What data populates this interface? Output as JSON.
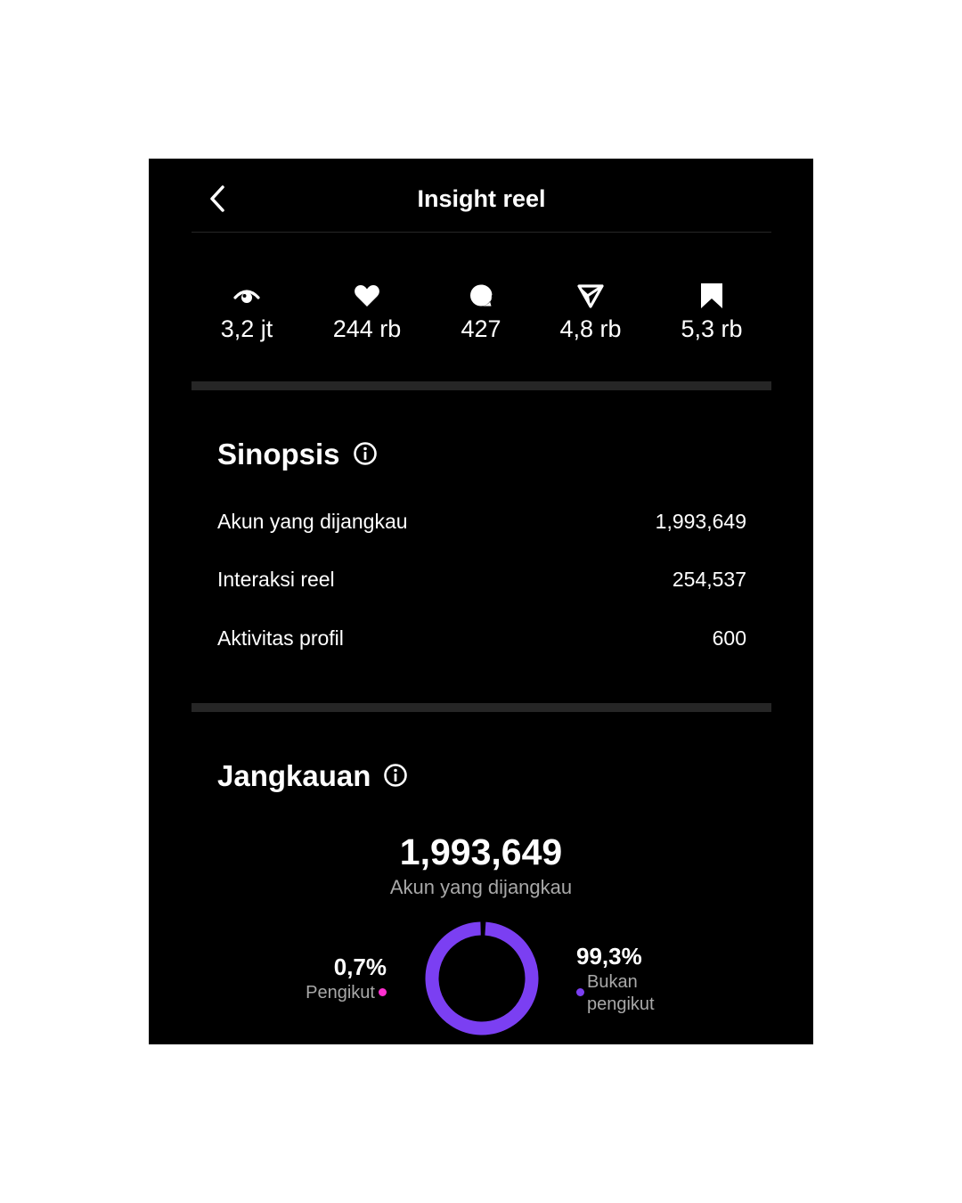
{
  "header": {
    "title": "Insight reel"
  },
  "stats": [
    {
      "icon": "eye-icon",
      "value": "3,2 jt"
    },
    {
      "icon": "heart-icon",
      "value": "244 rb"
    },
    {
      "icon": "comment-icon",
      "value": "427"
    },
    {
      "icon": "share-icon",
      "value": "4,8 rb"
    },
    {
      "icon": "bookmark-icon",
      "value": "5,3 rb"
    }
  ],
  "synopsis": {
    "title": "Sinopsis",
    "rows": [
      {
        "label": "Akun yang dijangkau",
        "value": "1,993,649"
      },
      {
        "label": "Interaksi reel",
        "value": "254,537"
      },
      {
        "label": "Aktivitas profil",
        "value": "600"
      }
    ]
  },
  "reach": {
    "title": "Jangkauan",
    "total": "1,993,649",
    "total_label": "Akun yang dijangkau",
    "followers": {
      "percent_text": "0,7%",
      "label": "Pengikut",
      "fraction": 0.007,
      "color": "#ff2fd0"
    },
    "non_followers": {
      "percent_text": "99,3%",
      "label_line1": "Bukan",
      "label_line2": "pengikut",
      "fraction": 0.993,
      "color": "#7b3ff2"
    }
  },
  "colors": {
    "background": "#000000",
    "divider": "#262626",
    "muted_text": "#a8a8a8"
  }
}
